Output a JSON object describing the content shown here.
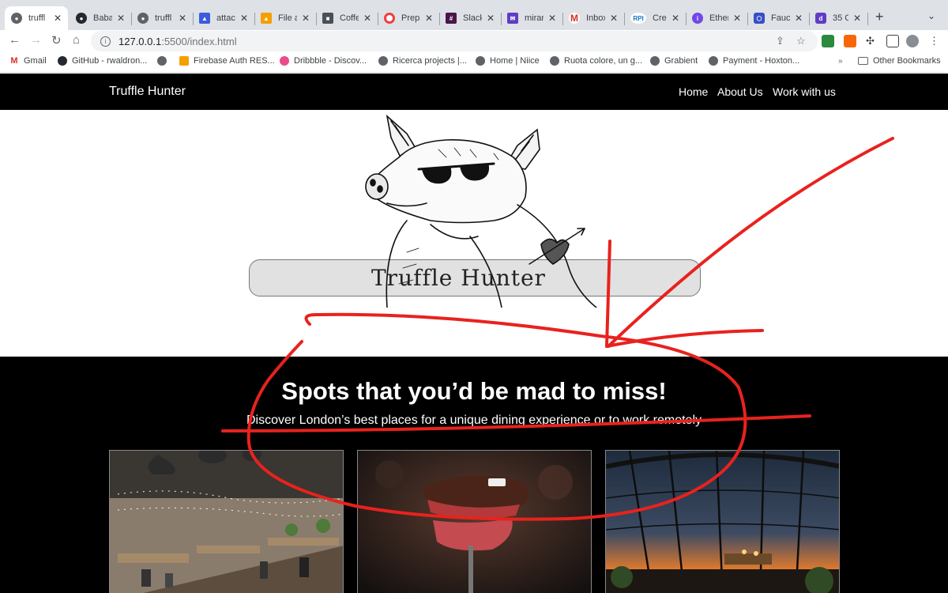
{
  "browser": {
    "tabs": [
      {
        "title": "truffl",
        "color": "#5f6368"
      },
      {
        "title": "Baba",
        "color": "#24292f"
      },
      {
        "title": "truffl",
        "color": "#5f6368"
      },
      {
        "title": "attac",
        "color": "#3b5bdb"
      },
      {
        "title": "File a",
        "color": "#f59f00"
      },
      {
        "title": "Coffe",
        "color": "#495057"
      },
      {
        "title": "Prepa",
        "color": "#f03e3e"
      },
      {
        "title": "Slack",
        "color": "#4a154b"
      },
      {
        "title": "miran",
        "color": "#5f3dc4"
      },
      {
        "title": "Inbox",
        "color": "#d93025"
      },
      {
        "title": "Cred",
        "color": "#1971c2"
      },
      {
        "title": "Ether",
        "color": "#7048e8"
      },
      {
        "title": "Fauc",
        "color": "#364fc7"
      },
      {
        "title": "35 C",
        "color": "#5f3dc4"
      }
    ],
    "url_host": "127.0.0.1",
    "url_path": ":5500/index.html",
    "bookmarks": [
      {
        "label": "Gmail",
        "color": "#d93025"
      },
      {
        "label": "GitHub - rwaldron...",
        "color": "#24292f"
      },
      {
        "label": "",
        "color": "#5f6368"
      },
      {
        "label": "Firebase Auth RES...",
        "color": "#f59f00"
      },
      {
        "label": "Dribbble - Discov...",
        "color": "#ea4c89"
      },
      {
        "label": "Ricerca projects |...",
        "color": "#5f6368"
      },
      {
        "label": "Home | Niice",
        "color": "#5f6368"
      },
      {
        "label": "Ruota colore, un g...",
        "color": "#5f6368"
      },
      {
        "label": "Grabient",
        "color": "#5f6368"
      },
      {
        "label": "Payment - Hoxton...",
        "color": "#5f6368"
      }
    ],
    "bookmarks_more": "»",
    "other_bookmarks": "Other Bookmarks"
  },
  "site": {
    "brand": "Truffle Hunter",
    "nav": [
      "Home",
      "About Us",
      "Work with us"
    ],
    "logo_text": "Truffle Hunter",
    "hero_title": "Spots that you’d be mad to miss!",
    "hero_subtitle": "Discover London’s best places for a unique dining experience or to work remotely"
  },
  "colors": {
    "annotation": "#e8221e",
    "nav_bg": "#000000",
    "tab_strip": "#dee1e6"
  }
}
